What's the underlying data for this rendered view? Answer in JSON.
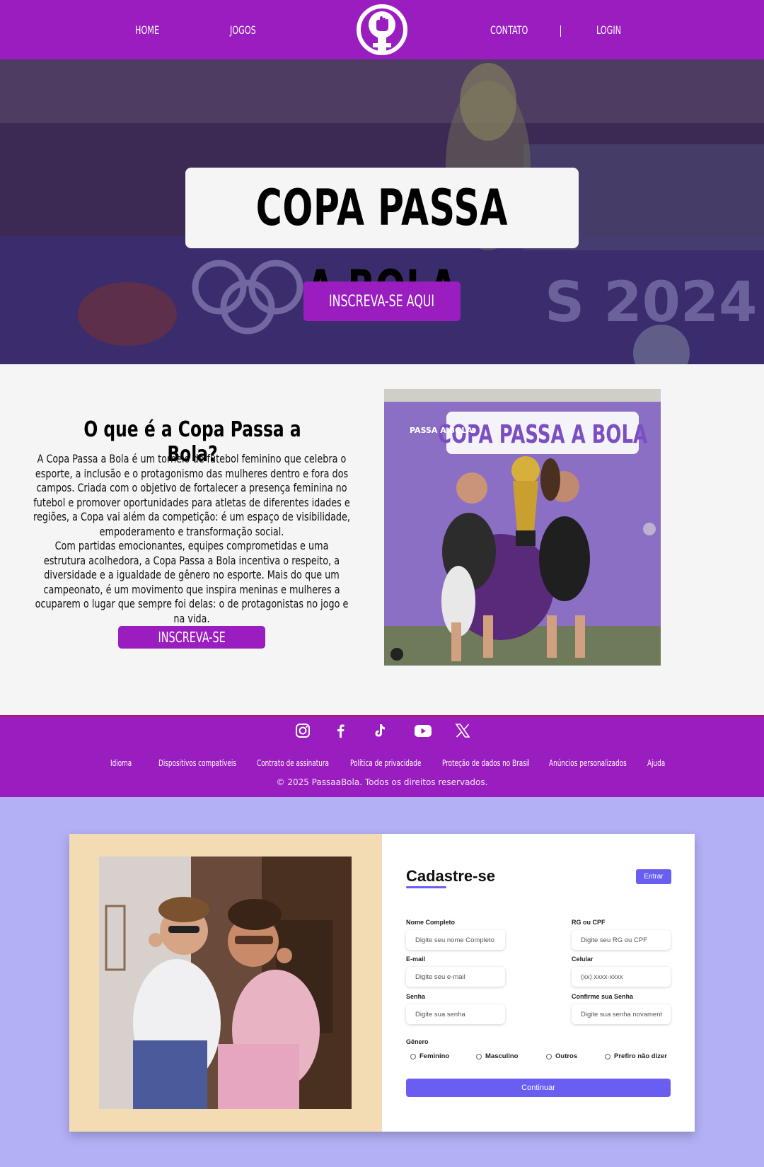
{
  "nav": {
    "home": "HOME",
    "jogos": "JOGOS",
    "contato": "CONTATO",
    "login": "LOGIN"
  },
  "hero": {
    "title": "COPA PASSA A BOLA",
    "cta": "INSCREVA-SE AQUI"
  },
  "about": {
    "title": "O que é a Copa Passa a Bola?",
    "paragraph1": "A Copa Passa a Bola é um torneio de futebol feminino que celebra o esporte, a inclusão e o protagonismo das mulheres dentro e fora dos campos. Criada com o objetivo de fortalecer a presença feminina no futebol e promover oportunidades para atletas de diferentes idades e regiões, a Copa vai além da competição: é um espaço de visibilidade, empoderamento e transformação social.",
    "paragraph2": "Com partidas emocionantes, equipes comprometidas e uma estrutura acolhedora, a Copa Passa a Bola incentiva o respeito, a diversidade e a igualdade de gênero no esporte. Mais do que um campeonato, é um movimento que inspira meninas e mulheres a ocuparem o lugar que sempre foi delas: o de protagonistas no jogo e na vida.",
    "cta": "INSCREVA-SE",
    "banner_text": "COPA PASSA A BOLA",
    "banner_small": "PASSA A BOLA"
  },
  "footer": {
    "socials": [
      "instagram-icon",
      "facebook-icon",
      "tiktok-icon",
      "youtube-icon",
      "x-icon"
    ],
    "links": [
      "Idioma",
      "Dispositivos compatíveis",
      "Contrato de assinatura",
      "Política de privacidade",
      "Proteção de dados no Brasil",
      "Anúncios personalizados",
      "Ajuda"
    ],
    "copyright": "© 2025 PassaaBola. Todos os direitos reservados."
  },
  "signup": {
    "title": "Cadastre-se",
    "login_button": "Entrar",
    "fields": {
      "nome": {
        "label": "Nome Completo",
        "placeholder": "Digite seu nome Completo"
      },
      "rg": {
        "label": "RG ou CPF",
        "placeholder": "Digite seu RG ou CPF"
      },
      "email": {
        "label": "E-mail",
        "placeholder": "Digite seu e-mail"
      },
      "celular": {
        "label": "Celular",
        "placeholder": "(xx) xxxx-xxxx"
      },
      "senha": {
        "label": "Senha",
        "placeholder": "Digite sua senha"
      },
      "confirma": {
        "label": "Confirme sua Senha",
        "placeholder": "Digite sua senha novament"
      }
    },
    "gender_label": "Gênero",
    "genders": [
      "Feminino",
      "Masculino",
      "Outros",
      "Prefiro não dizer"
    ],
    "submit": "Continuar"
  },
  "colors": {
    "purple": "#9a1dbf",
    "lavender": "#b4b0f6",
    "indigo": "#6a5df2",
    "beige": "#f3dcb3"
  }
}
